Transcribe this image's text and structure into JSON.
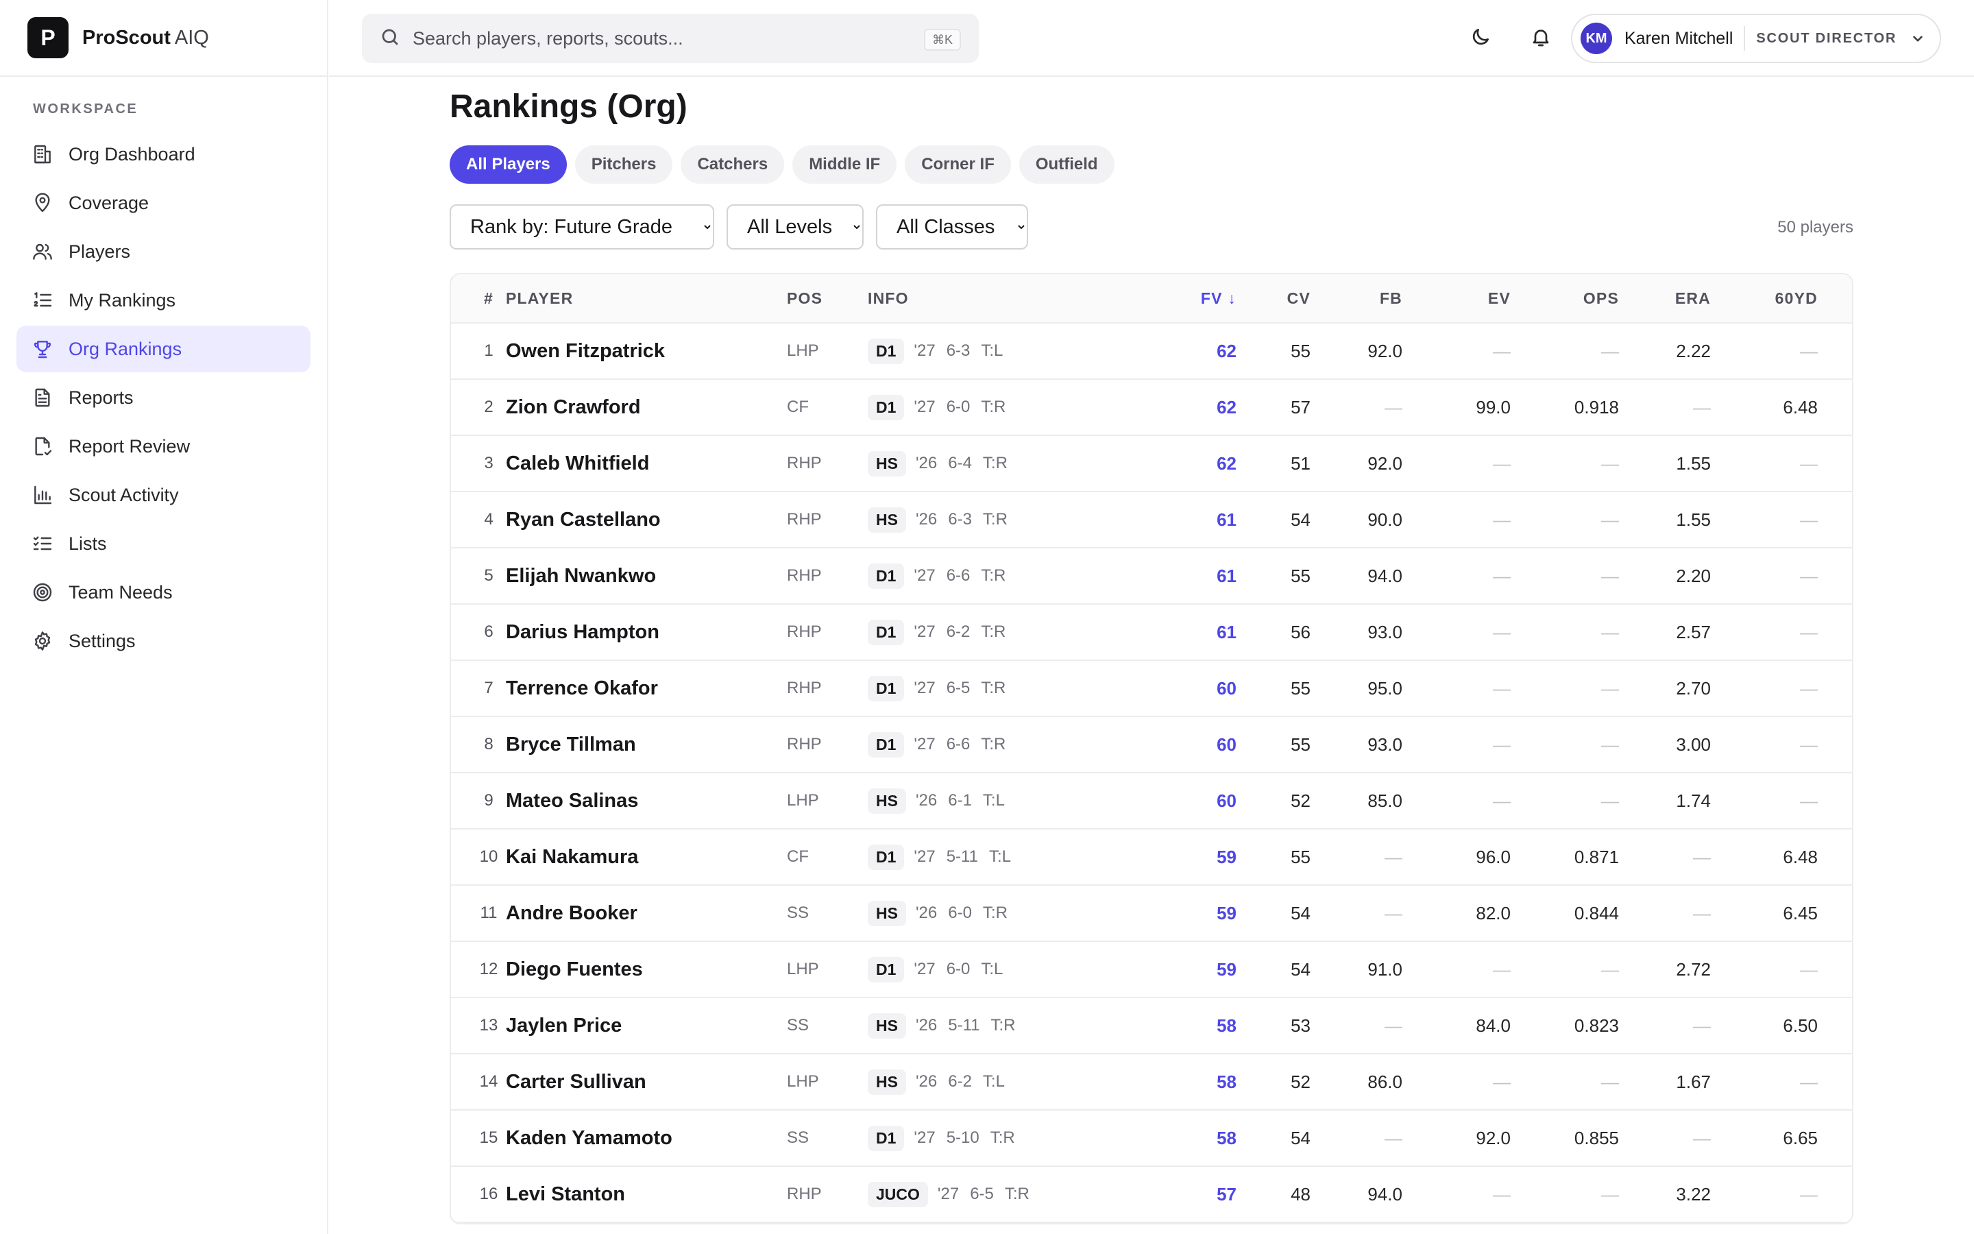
{
  "brand": {
    "logo_letter": "P",
    "name": "ProScout",
    "suffix": "AIQ"
  },
  "sidebar": {
    "section_label": "WORKSPACE",
    "items": [
      {
        "label": "Org Dashboard",
        "icon": "building-icon"
      },
      {
        "label": "Coverage",
        "icon": "map-pin-icon"
      },
      {
        "label": "Players",
        "icon": "users-icon"
      },
      {
        "label": "My Rankings",
        "icon": "list-ordered-icon"
      },
      {
        "label": "Org Rankings",
        "icon": "trophy-icon",
        "active": true
      },
      {
        "label": "Reports",
        "icon": "file-text-icon"
      },
      {
        "label": "Report Review",
        "icon": "file-check-icon"
      },
      {
        "label": "Scout Activity",
        "icon": "bar-chart-icon"
      },
      {
        "label": "Lists",
        "icon": "list-checks-icon"
      },
      {
        "label": "Team Needs",
        "icon": "target-icon"
      },
      {
        "label": "Settings",
        "icon": "gear-icon"
      }
    ]
  },
  "header": {
    "search_placeholder": "Search players, reports, scouts...",
    "search_shortcut": "⌘K",
    "user": {
      "initials": "KM",
      "name": "Karen Mitchell",
      "role": "SCOUT DIRECTOR"
    }
  },
  "main": {
    "title": "Rankings (Org)",
    "tabs": [
      "All Players",
      "Pitchers",
      "Catchers",
      "Middle IF",
      "Corner IF",
      "Outfield"
    ],
    "active_tab": 0,
    "filters": {
      "rank_by": "Rank by: Future Grade",
      "levels": "All Levels",
      "classes": "All Classes"
    },
    "player_count": "50 players",
    "columns": {
      "rank": "#",
      "player": "PLAYER",
      "pos": "POS",
      "info": "INFO",
      "fv": "FV ↓",
      "cv": "CV",
      "fb": "FB",
      "ev": "EV",
      "ops": "OPS",
      "era": "ERA",
      "yd": "60YD"
    },
    "rows": [
      {
        "rank": "1",
        "name": "Owen Fitzpatrick",
        "pos": "LHP",
        "level": "D1",
        "cls": "'27",
        "ht": "6-3",
        "th": "T:L",
        "fv": "62",
        "cv": "55",
        "fb": "92.0",
        "ev": "—",
        "ops": "—",
        "era": "2.22",
        "yd": "—"
      },
      {
        "rank": "2",
        "name": "Zion Crawford",
        "pos": "CF",
        "level": "D1",
        "cls": "'27",
        "ht": "6-0",
        "th": "T:R",
        "fv": "62",
        "cv": "57",
        "fb": "—",
        "ev": "99.0",
        "ops": "0.918",
        "era": "—",
        "yd": "6.48"
      },
      {
        "rank": "3",
        "name": "Caleb Whitfield",
        "pos": "RHP",
        "level": "HS",
        "cls": "'26",
        "ht": "6-4",
        "th": "T:R",
        "fv": "62",
        "cv": "51",
        "fb": "92.0",
        "ev": "—",
        "ops": "—",
        "era": "1.55",
        "yd": "—"
      },
      {
        "rank": "4",
        "name": "Ryan Castellano",
        "pos": "RHP",
        "level": "HS",
        "cls": "'26",
        "ht": "6-3",
        "th": "T:R",
        "fv": "61",
        "cv": "54",
        "fb": "90.0",
        "ev": "—",
        "ops": "—",
        "era": "1.55",
        "yd": "—"
      },
      {
        "rank": "5",
        "name": "Elijah Nwankwo",
        "pos": "RHP",
        "level": "D1",
        "cls": "'27",
        "ht": "6-6",
        "th": "T:R",
        "fv": "61",
        "cv": "55",
        "fb": "94.0",
        "ev": "—",
        "ops": "—",
        "era": "2.20",
        "yd": "—"
      },
      {
        "rank": "6",
        "name": "Darius Hampton",
        "pos": "RHP",
        "level": "D1",
        "cls": "'27",
        "ht": "6-2",
        "th": "T:R",
        "fv": "61",
        "cv": "56",
        "fb": "93.0",
        "ev": "—",
        "ops": "—",
        "era": "2.57",
        "yd": "—"
      },
      {
        "rank": "7",
        "name": "Terrence Okafor",
        "pos": "RHP",
        "level": "D1",
        "cls": "'27",
        "ht": "6-5",
        "th": "T:R",
        "fv": "60",
        "cv": "55",
        "fb": "95.0",
        "ev": "—",
        "ops": "—",
        "era": "2.70",
        "yd": "—"
      },
      {
        "rank": "8",
        "name": "Bryce Tillman",
        "pos": "RHP",
        "level": "D1",
        "cls": "'27",
        "ht": "6-6",
        "th": "T:R",
        "fv": "60",
        "cv": "55",
        "fb": "93.0",
        "ev": "—",
        "ops": "—",
        "era": "3.00",
        "yd": "—"
      },
      {
        "rank": "9",
        "name": "Mateo Salinas",
        "pos": "LHP",
        "level": "HS",
        "cls": "'26",
        "ht": "6-1",
        "th": "T:L",
        "fv": "60",
        "cv": "52",
        "fb": "85.0",
        "ev": "—",
        "ops": "—",
        "era": "1.74",
        "yd": "—"
      },
      {
        "rank": "10",
        "name": "Kai Nakamura",
        "pos": "CF",
        "level": "D1",
        "cls": "'27",
        "ht": "5-11",
        "th": "T:L",
        "fv": "59",
        "cv": "55",
        "fb": "—",
        "ev": "96.0",
        "ops": "0.871",
        "era": "—",
        "yd": "6.48"
      },
      {
        "rank": "11",
        "name": "Andre Booker",
        "pos": "SS",
        "level": "HS",
        "cls": "'26",
        "ht": "6-0",
        "th": "T:R",
        "fv": "59",
        "cv": "54",
        "fb": "—",
        "ev": "82.0",
        "ops": "0.844",
        "era": "—",
        "yd": "6.45"
      },
      {
        "rank": "12",
        "name": "Diego Fuentes",
        "pos": "LHP",
        "level": "D1",
        "cls": "'27",
        "ht": "6-0",
        "th": "T:L",
        "fv": "59",
        "cv": "54",
        "fb": "91.0",
        "ev": "—",
        "ops": "—",
        "era": "2.72",
        "yd": "—"
      },
      {
        "rank": "13",
        "name": "Jaylen Price",
        "pos": "SS",
        "level": "HS",
        "cls": "'26",
        "ht": "5-11",
        "th": "T:R",
        "fv": "58",
        "cv": "53",
        "fb": "—",
        "ev": "84.0",
        "ops": "0.823",
        "era": "—",
        "yd": "6.50"
      },
      {
        "rank": "14",
        "name": "Carter Sullivan",
        "pos": "LHP",
        "level": "HS",
        "cls": "'26",
        "ht": "6-2",
        "th": "T:L",
        "fv": "58",
        "cv": "52",
        "fb": "86.0",
        "ev": "—",
        "ops": "—",
        "era": "1.67",
        "yd": "—"
      },
      {
        "rank": "15",
        "name": "Kaden Yamamoto",
        "pos": "SS",
        "level": "D1",
        "cls": "'27",
        "ht": "5-10",
        "th": "T:R",
        "fv": "58",
        "cv": "54",
        "fb": "—",
        "ev": "92.0",
        "ops": "0.855",
        "era": "—",
        "yd": "6.65"
      },
      {
        "rank": "16",
        "name": "Levi Stanton",
        "pos": "RHP",
        "level": "JUCO",
        "cls": "'27",
        "ht": "6-5",
        "th": "T:R",
        "fv": "57",
        "cv": "48",
        "fb": "94.0",
        "ev": "—",
        "ops": "—",
        "era": "3.22",
        "yd": "—"
      }
    ]
  }
}
